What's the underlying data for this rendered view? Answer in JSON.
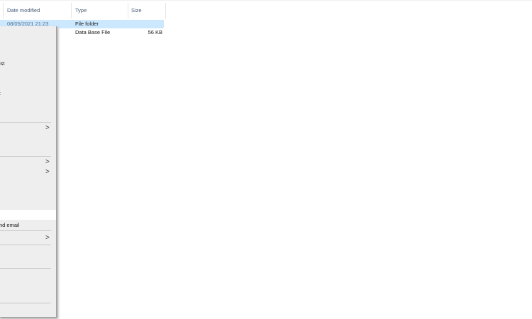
{
  "columns": {
    "date_modified": "Date modified",
    "type": "Type",
    "size": "Size"
  },
  "rows": [
    {
      "date": "08/05/2021 21:23",
      "type": "File folder",
      "size": ""
    },
    {
      "date": "",
      "type": "Data Base File",
      "size": "56 KB"
    }
  ],
  "context_menu": {
    "items": [
      {
        "label": "ist"
      },
      {
        "label": ":"
      },
      {
        "label": "nd email"
      }
    ],
    "submenu_arrow": ">"
  },
  "colors": {
    "selection": "#cce8ff",
    "menu_bg": "#eeeeee",
    "header_text": "#4c607a"
  }
}
